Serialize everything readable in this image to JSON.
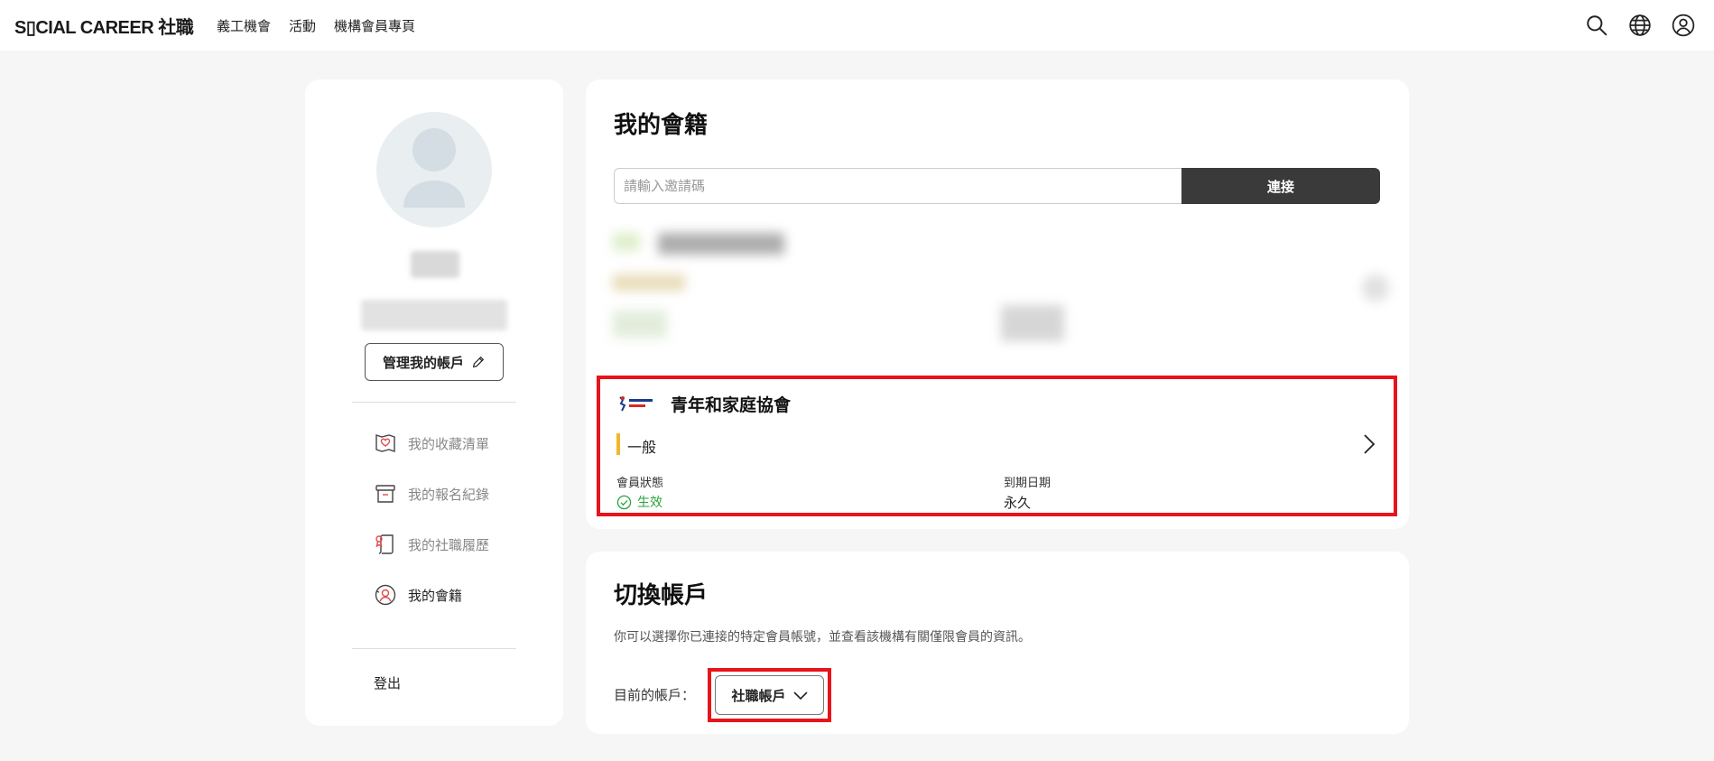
{
  "header": {
    "logo": "S▯CIAL CAREER 社職",
    "nav": [
      "義工機會",
      "活動",
      "機構會員專頁"
    ]
  },
  "sidebar": {
    "manage_label": "管理我的帳戶",
    "items": [
      {
        "label": "我的收藏清單",
        "icon": "favorites-icon"
      },
      {
        "label": "我的報名紀錄",
        "icon": "archive-icon"
      },
      {
        "label": "我的社職履歷",
        "icon": "resume-icon"
      },
      {
        "label": "我的會籍",
        "icon": "membership-icon"
      }
    ],
    "logout_label": "登出"
  },
  "membership": {
    "title": "我的會籍",
    "invite_placeholder": "請輸入邀請碼",
    "connect_label": "連接",
    "entry": {
      "org_name": "青年和家庭協會",
      "tier": "一般",
      "status_label": "會員狀態",
      "status_value": "生效",
      "expiry_label": "到期日期",
      "expiry_value": "永久"
    }
  },
  "switch_account": {
    "title": "切換帳戶",
    "description": "你可以選擇你已連接的特定會員帳號，並查看該機構有關僅限會員的資訊。",
    "current_label": "目前的帳戶：",
    "current_value": "社職帳戶"
  },
  "colors": {
    "highlight": "#e8141b",
    "active_status": "#2aa33b",
    "tier_accent": "#f1b72a",
    "connect_bg": "#3a3a3a"
  }
}
